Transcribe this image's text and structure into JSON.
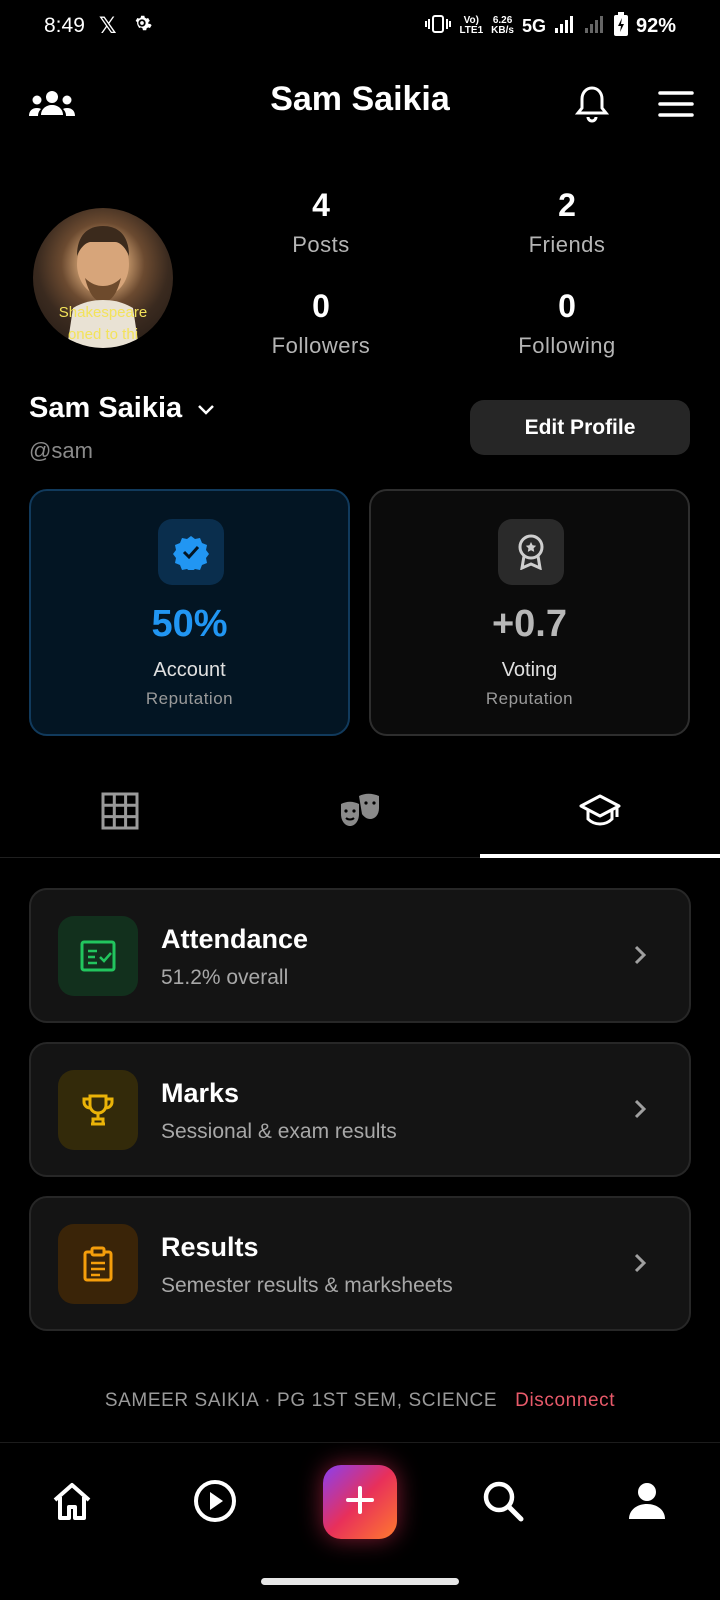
{
  "status_bar": {
    "time": "8:49",
    "volte": "Vo)",
    "lte": "LTE1",
    "speed_value": "6.26",
    "speed_unit": "KB/s",
    "network": "5G",
    "battery": "92%"
  },
  "header": {
    "title": "Sam Saikia"
  },
  "profile": {
    "avatar_caption_line1": "Shakespeare",
    "avatar_caption_line2": "oned to thi",
    "stats": [
      {
        "value": "4",
        "label": "Posts"
      },
      {
        "value": "2",
        "label": "Friends"
      },
      {
        "value": "0",
        "label": "Followers"
      },
      {
        "value": "0",
        "label": "Following"
      }
    ],
    "name": "Sam Saikia",
    "handle": "@sam",
    "edit_label": "Edit Profile"
  },
  "reputation": {
    "account": {
      "value": "50%",
      "title": "Account",
      "subtitle": "Reputation",
      "color": "#2196f3"
    },
    "voting": {
      "value": "+0.7",
      "title": "Voting",
      "subtitle": "Reputation"
    }
  },
  "tabs": {
    "icons": [
      "grid-icon",
      "masks-icon",
      "graduation-cap-icon"
    ],
    "active": "graduation-cap-icon"
  },
  "academics": [
    {
      "title": "Attendance",
      "subtitle": "51.2% overall",
      "color": "#22c55e"
    },
    {
      "title": "Marks",
      "subtitle": "Sessional & exam results",
      "color": "#eab308"
    },
    {
      "title": "Results",
      "subtitle": "Semester results & marksheets",
      "color": "#f59e0b"
    }
  ],
  "footer": {
    "student_info": "SAMEER SAIKIA · PG 1ST SEM, SCIENCE",
    "disconnect": "Disconnect"
  },
  "bottom_nav": [
    "home-icon",
    "play-icon",
    "plus-icon",
    "search-icon",
    "profile-icon"
  ]
}
